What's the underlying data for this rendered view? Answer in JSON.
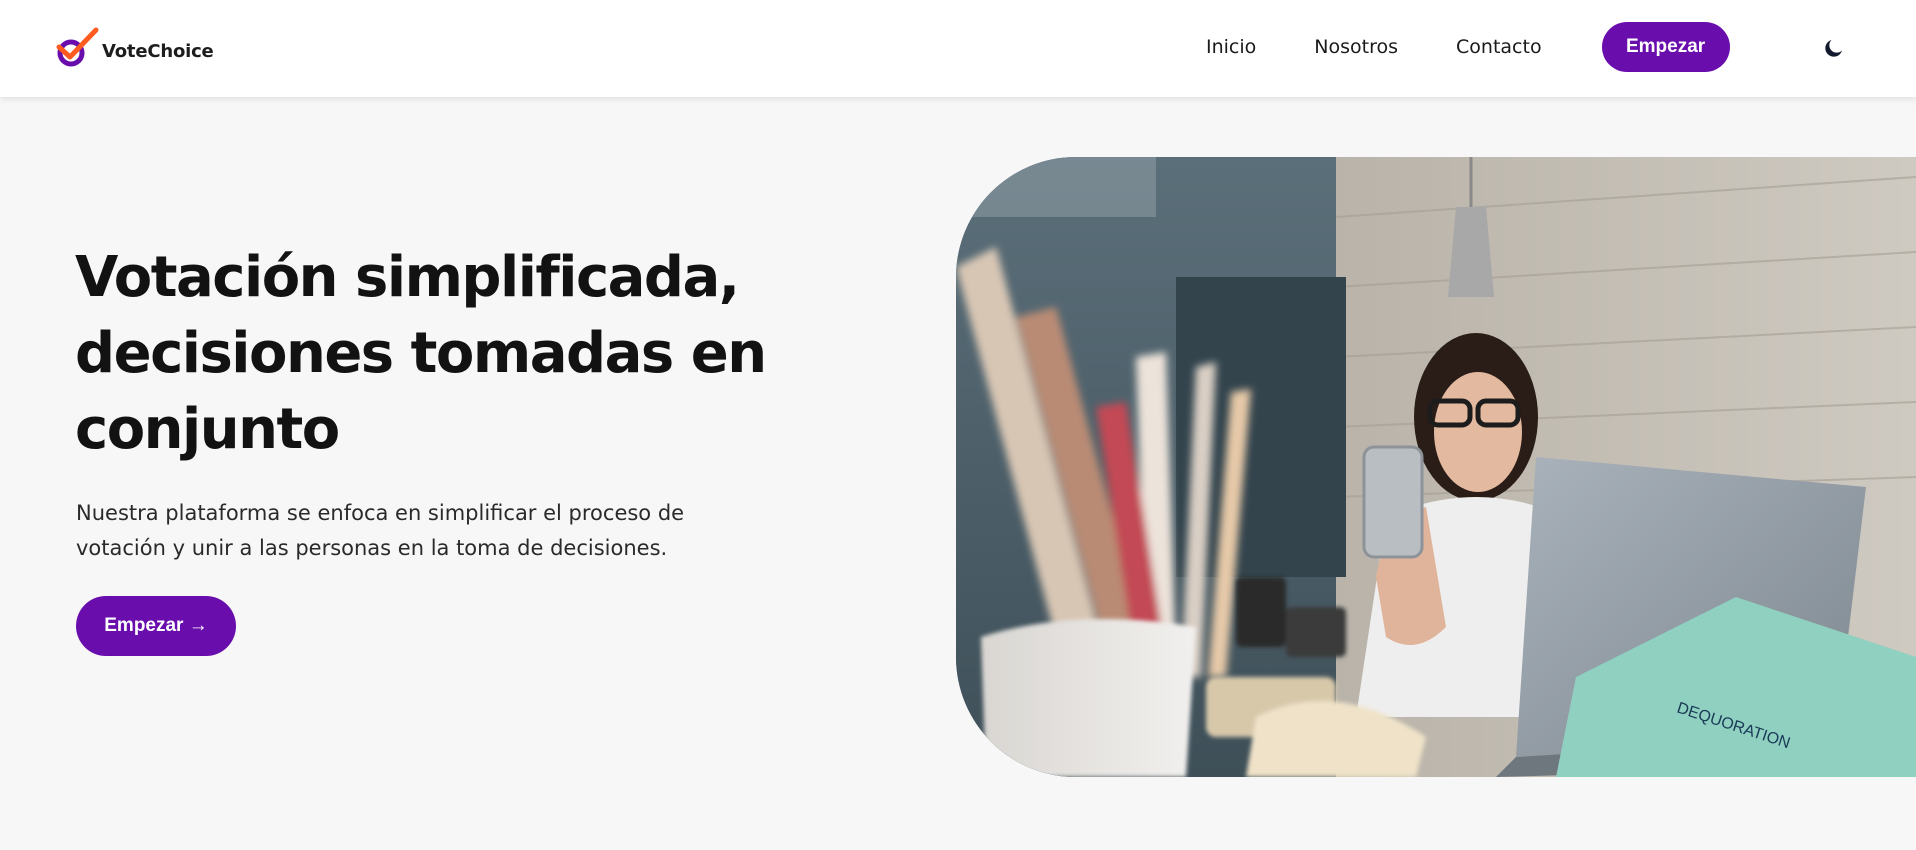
{
  "header": {
    "brand": "VoteChoice",
    "nav": [
      "Inicio",
      "Nosotros",
      "Contacto"
    ],
    "cta_label": "Empezar",
    "theme_icon": "moon-icon"
  },
  "hero": {
    "title": "Votación simplificada, decisiones tomadas en conjunto",
    "description": "Nuestra plataforma se enfoca en simplificar el proceso de votación y unir a las personas en la toma de decisiones.",
    "cta_label": "Empezar →",
    "image_text": "DEQUORATION"
  },
  "colors": {
    "accent": "#6a0dad",
    "logo_orange": "#ff5a1f",
    "background": "#f7f7f7",
    "text": "#141414"
  }
}
